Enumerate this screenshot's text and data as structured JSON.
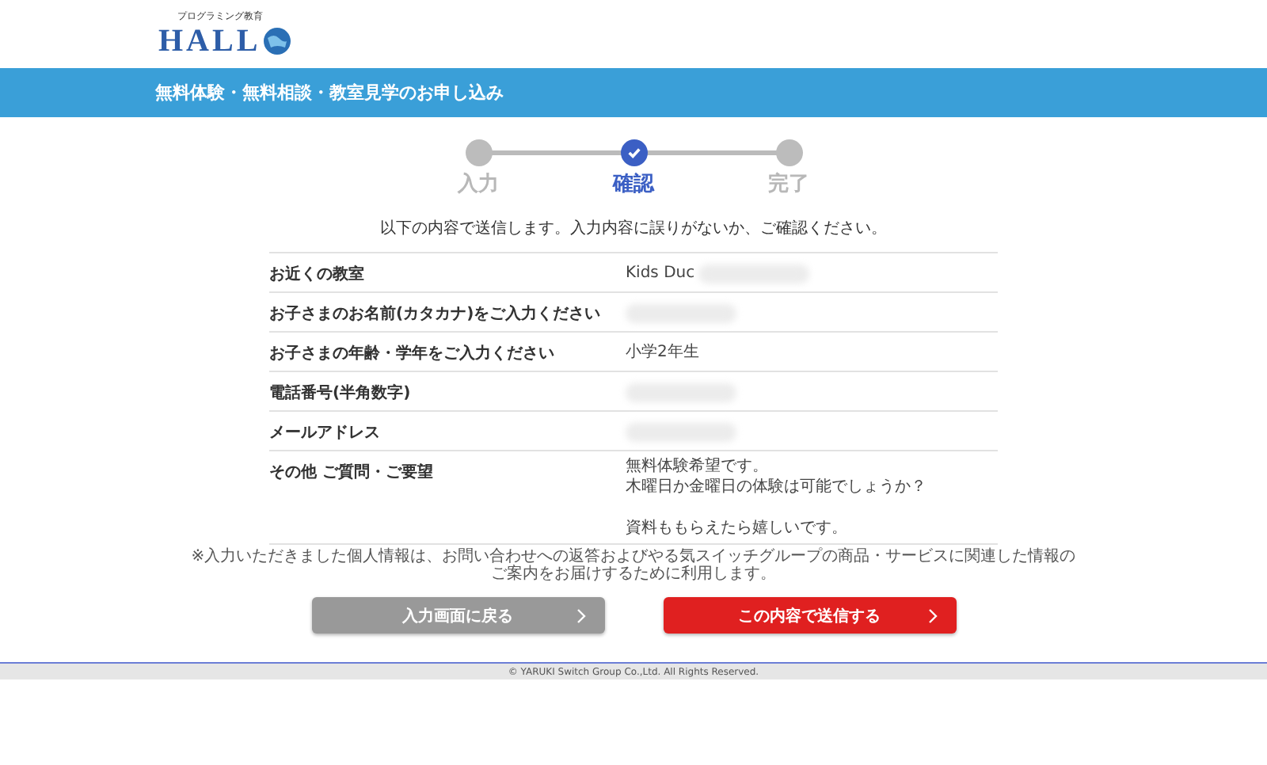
{
  "logo": {
    "tagline": "プログラミング教育",
    "wordmark": "HALL"
  },
  "banner": {
    "title": "無料体験・無料相談・教室見学のお申し込み"
  },
  "steps": [
    {
      "label": "入力",
      "selected": false
    },
    {
      "label": "確認",
      "selected": true
    },
    {
      "label": "完了",
      "selected": false
    }
  ],
  "intro": "以下の内容で送信します。入力内容に誤りがないか、ご確認ください。",
  "rows": [
    {
      "label": "お近くの教室",
      "value_lines": [
        "Kids Duc"
      ],
      "redacted": true
    },
    {
      "label": "お子さまのお名前(カタカナ)をご入力ください",
      "value_lines": [],
      "redacted": true
    },
    {
      "label": "お子さまの年齢・学年をご入力ください",
      "value_lines": [
        "小学2年生"
      ],
      "redacted": false
    },
    {
      "label": "電話番号(半角数字)",
      "value_lines": [],
      "redacted": true
    },
    {
      "label": "メールアドレス",
      "value_lines": [],
      "redacted": true
    },
    {
      "label": "その他 ご質問・ご要望",
      "value_lines": [
        "無料体験希望です。",
        "木曜日か金曜日の体験は可能でしょうか？"
      ],
      "more_lines": [
        "資料ももらえたら嬉しいです。"
      ],
      "redacted": false
    }
  ],
  "note": "※入力いただきました個人情報は、お問い合わせへの返答およびやる気スイッチグループの商品・サービスに関連した情報のご案内をお届けするために利用します。",
  "buttons": [
    {
      "label": "入力画面に戻る",
      "kind": "back"
    },
    {
      "label": "この内容で送信する",
      "kind": "submit"
    }
  ],
  "footer": "© YARUKI Switch Group Co.,Ltd. All Rights Reserved."
}
